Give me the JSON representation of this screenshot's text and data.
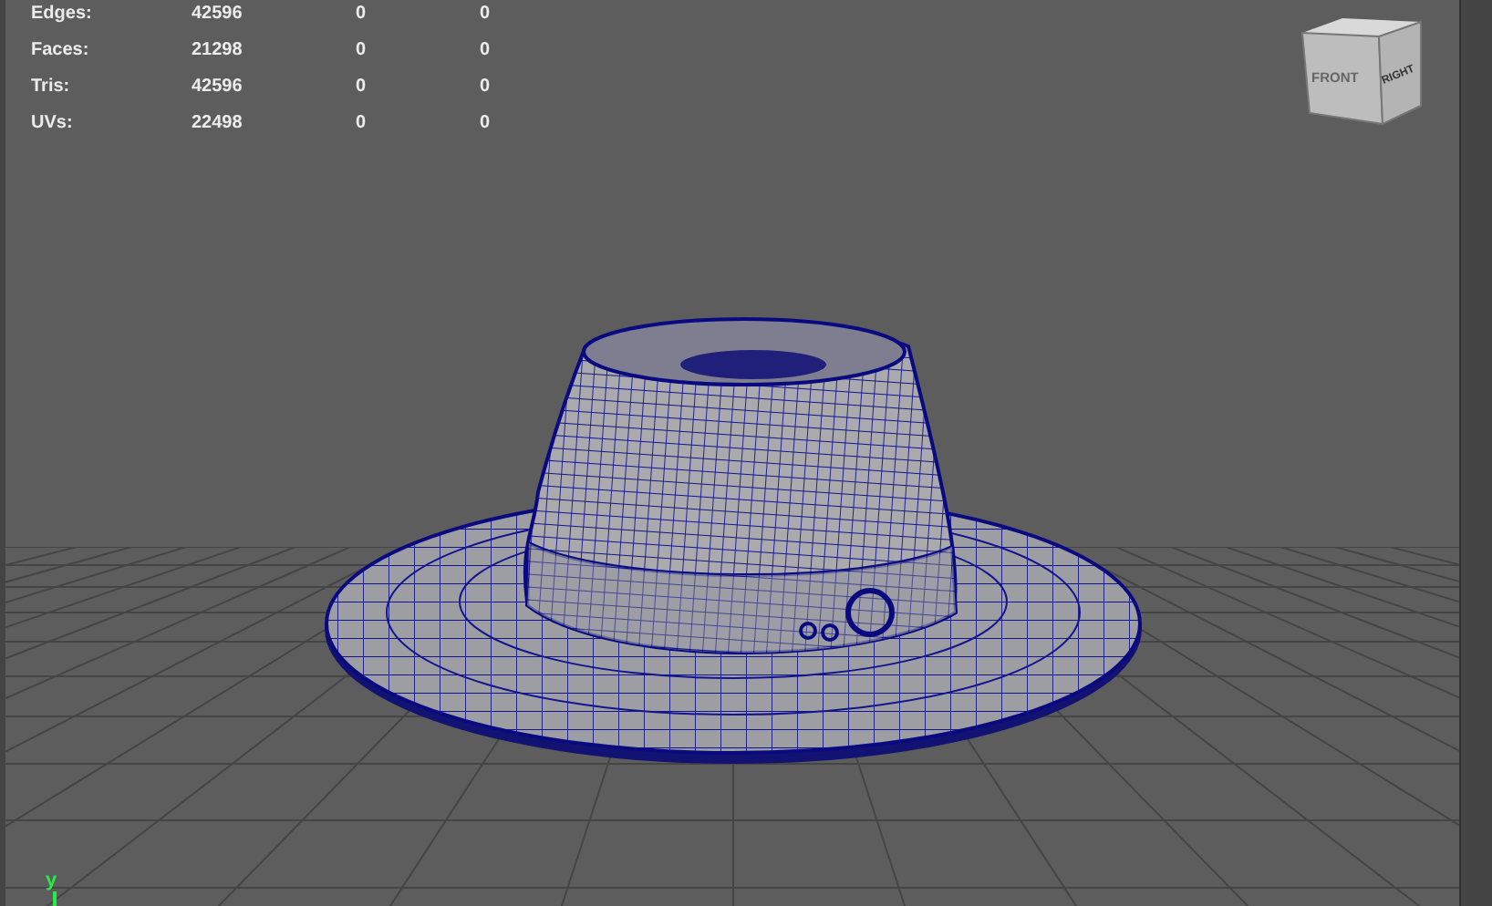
{
  "hud": {
    "rows": [
      {
        "label": "Edges:",
        "values": [
          "42596",
          "0",
          "0"
        ]
      },
      {
        "label": "Faces:",
        "values": [
          "21298",
          "0",
          "0"
        ]
      },
      {
        "label": "Tris:",
        "values": [
          "42596",
          "0",
          "0"
        ]
      },
      {
        "label": "UVs:",
        "values": [
          "22498",
          "0",
          "0"
        ]
      }
    ]
  },
  "view_cube": {
    "faces": [
      "FRONT",
      "RIGHT"
    ]
  },
  "axis_label": "y"
}
